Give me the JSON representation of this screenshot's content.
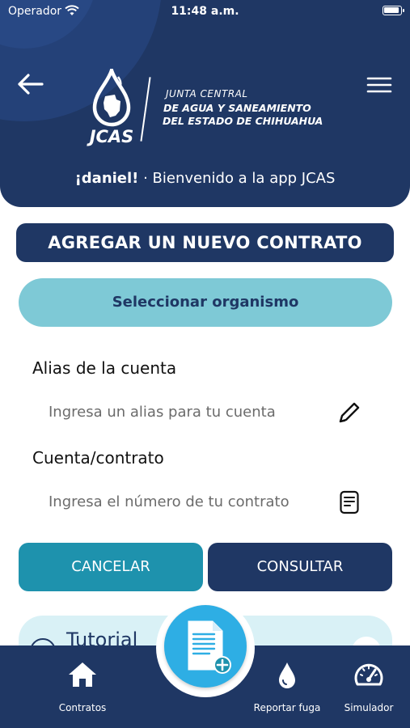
{
  "status_bar": {
    "carrier": "Operador",
    "time": "11:48 a.m."
  },
  "header": {
    "logo_text": "JCAS",
    "org_line1": "JUNTA CENTRAL",
    "org_line2": "DE AGUA Y SANEAMIENTO",
    "org_line3": "DEL ESTADO DE CHIHUAHUA",
    "user_greeting": "¡daniel!",
    "welcome_text": " · Bienvenido a la app JCAS"
  },
  "form": {
    "title": "AGREGAR UN NUEVO CONTRATO",
    "select_org_label": "Seleccionar organismo",
    "alias_label": "Alias de la cuenta",
    "alias_placeholder": "Ingresa un alias para tu cuenta",
    "contract_label": "Cuenta/contrato",
    "contract_placeholder": "Ingresa el número de tu contrato",
    "cancel_label": "CANCELAR",
    "consult_label": "CONSULTAR"
  },
  "tutorial": {
    "title": "Tutorial",
    "subtitle": "v"
  },
  "bottom_nav": {
    "items": [
      {
        "label": "Contratos",
        "icon": "home-icon"
      },
      {
        "label": "Reportar fuga",
        "icon": "water-drop-icon"
      },
      {
        "label": "Simulador",
        "icon": "gauge-icon"
      }
    ],
    "fab_icon": "add-document-icon"
  },
  "colors": {
    "navy": "#1f3764",
    "teal": "#1e92ad",
    "light_teal": "#7ec9d6",
    "fab_blue": "#2eaee4"
  }
}
